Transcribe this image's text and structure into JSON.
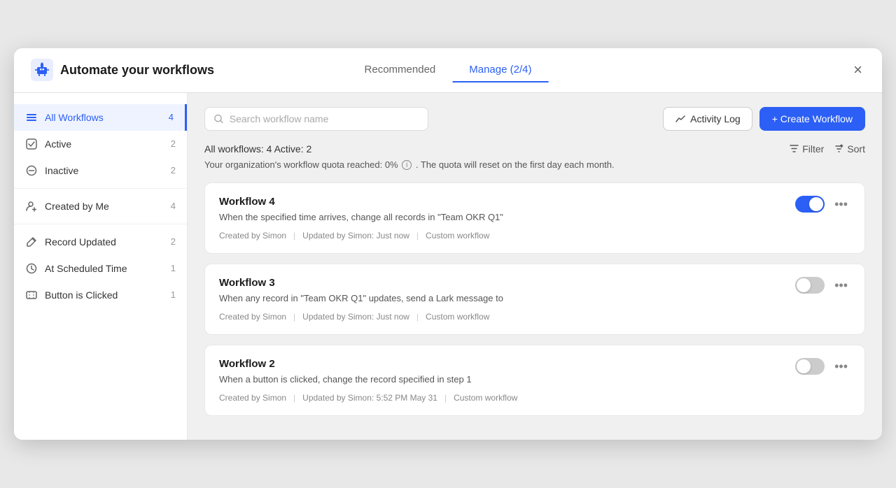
{
  "header": {
    "title": "Automate your workflows",
    "tabs": [
      {
        "id": "recommended",
        "label": "Recommended",
        "active": false
      },
      {
        "id": "manage",
        "label": "Manage (2/4)",
        "active": true
      }
    ],
    "close_label": "×"
  },
  "sidebar": {
    "items": [
      {
        "id": "all-workflows",
        "label": "All Workflows",
        "count": "4",
        "selected": true,
        "icon": "menu"
      },
      {
        "id": "active",
        "label": "Active",
        "count": "2",
        "selected": false,
        "icon": "checkbox"
      },
      {
        "id": "inactive",
        "label": "Inactive",
        "count": "2",
        "selected": false,
        "icon": "circle-minus"
      },
      {
        "id": "created-by-me",
        "label": "Created by Me",
        "count": "4",
        "selected": false,
        "icon": "person-plus"
      },
      {
        "id": "record-updated",
        "label": "Record Updated",
        "count": "2",
        "selected": false,
        "icon": "pencil"
      },
      {
        "id": "at-scheduled-time",
        "label": "At Scheduled Time",
        "count": "1",
        "selected": false,
        "icon": "clock"
      },
      {
        "id": "button-is-clicked",
        "label": "Button is Clicked",
        "count": "1",
        "selected": false,
        "icon": "cursor"
      }
    ]
  },
  "toolbar": {
    "search_placeholder": "Search workflow name",
    "activity_log_label": "Activity Log",
    "create_workflow_label": "+ Create Workflow"
  },
  "info": {
    "summary": "All workflows: 4 Active: 2",
    "quota_text": "Your organization's workflow quota reached: 0%",
    "quota_suffix": ". The quota will reset on the first day each month.",
    "filter_label": "Filter",
    "sort_label": "Sort"
  },
  "workflows": [
    {
      "id": "workflow-4",
      "title": "Workflow 4",
      "description": "When the specified time arrives, change all records in \"Team OKR Q1\"",
      "created_by": "Created by Simon",
      "updated_by": "Updated by Simon: Just now",
      "type": "Custom workflow",
      "active": true
    },
    {
      "id": "workflow-3",
      "title": "Workflow 3",
      "description": "When any record in \"Team OKR Q1\" updates, send a Lark message to",
      "created_by": "Created by Simon",
      "updated_by": "Updated by Simon: Just now",
      "type": "Custom workflow",
      "active": false
    },
    {
      "id": "workflow-2",
      "title": "Workflow 2",
      "description": "When a button is clicked, change the record specified in step 1",
      "created_by": "Created by Simon",
      "updated_by": "Updated by Simon: 5:52 PM May 31",
      "type": "Custom workflow",
      "active": false
    }
  ],
  "colors": {
    "accent": "#2b5ff5",
    "toggle_on": "#2b5ff5",
    "toggle_off": "#ccc"
  }
}
